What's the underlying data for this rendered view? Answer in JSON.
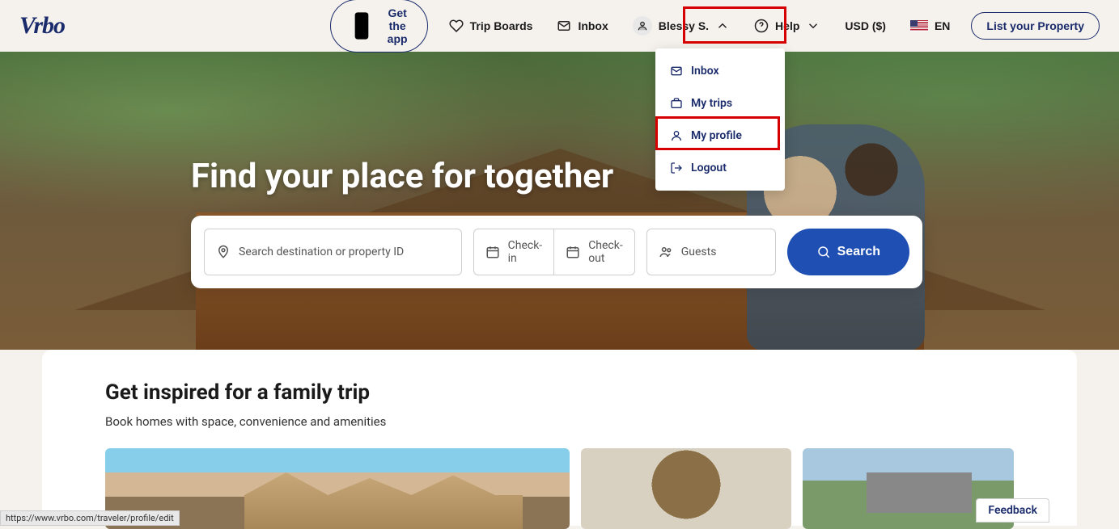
{
  "header": {
    "logo": "Vrbo",
    "get_app": "Get the app",
    "trip_boards": "Trip Boards",
    "inbox": "Inbox",
    "account_name": "Blessy S.",
    "help": "Help",
    "currency": "USD ($)",
    "lang": "EN",
    "list_property": "List your Property"
  },
  "dropdown": {
    "items": [
      {
        "label": "Inbox",
        "icon": "mail"
      },
      {
        "label": "My trips",
        "icon": "briefcase"
      },
      {
        "label": "My profile",
        "icon": "user"
      },
      {
        "label": "Logout",
        "icon": "logout"
      }
    ]
  },
  "hero": {
    "title": "Find your place for together",
    "search": {
      "dest_placeholder": "Search destination or property ID",
      "checkin": "Check-in",
      "checkout": "Check-out",
      "guests": "Guests",
      "button": "Search"
    }
  },
  "section": {
    "title": "Get inspired for a family trip",
    "subtitle": "Book homes with space, convenience and amenities"
  },
  "feedback": "Feedback",
  "status_url": "https://www.vrbo.com/traveler/profile/edit"
}
